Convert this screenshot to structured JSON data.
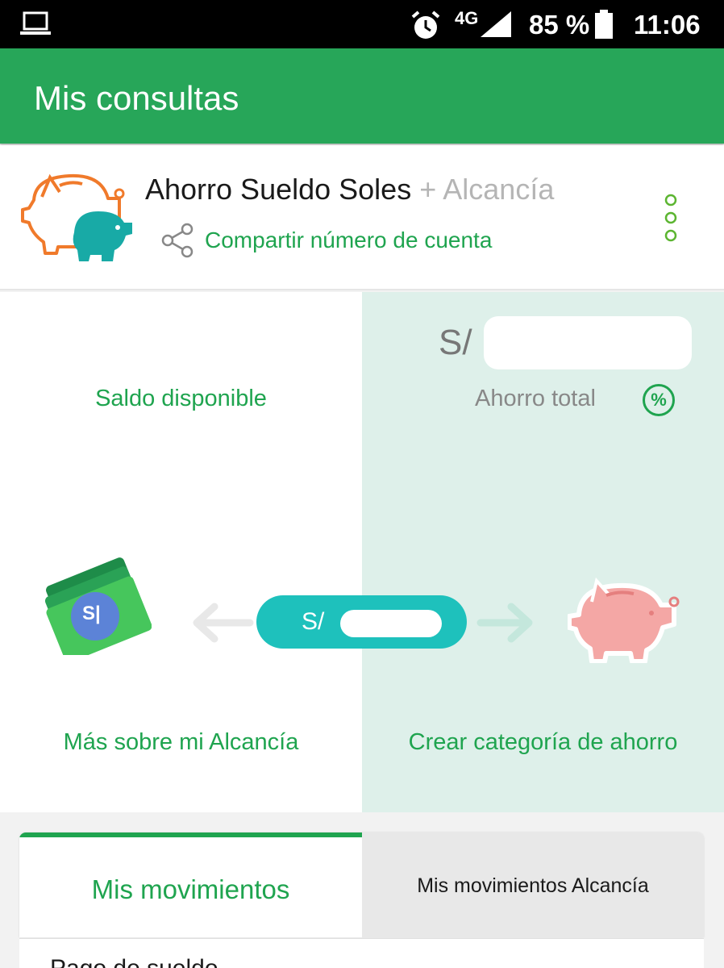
{
  "status_bar": {
    "network": "4G",
    "battery": "85 %",
    "time": "11:06",
    "icons": [
      "laptop-icon",
      "alarm-icon",
      "signal-icon",
      "battery-icon"
    ]
  },
  "app_bar": {
    "title": "Mis consultas"
  },
  "account": {
    "name": "Ahorro Sueldo Soles",
    "plus": "+ Alcancía",
    "share_label": "Compartir número de cuenta",
    "icons": [
      "piggy-bank-icon",
      "share-icon",
      "more-vertical-icon"
    ]
  },
  "balances": {
    "available_label": "Saldo disponible",
    "savings_currency": "S/",
    "savings_label": "Ahorro total",
    "percent_badge": "%",
    "transfer_currency": "S/",
    "more_link": "Más sobre mi Alcancía",
    "create_link": "Crear categoría de ahorro",
    "money_badge": "S|"
  },
  "tabs": [
    {
      "label": "Mis movimientos",
      "active": true
    },
    {
      "label": "Mis movimientos Alcancía",
      "active": false
    }
  ],
  "movements": [
    {
      "label": "Pago de sueldo"
    }
  ],
  "colors": {
    "brand_green": "#27a659",
    "link_green": "#1fa44f",
    "teal": "#1ec1bc",
    "savings_panel": "#def0ea"
  }
}
